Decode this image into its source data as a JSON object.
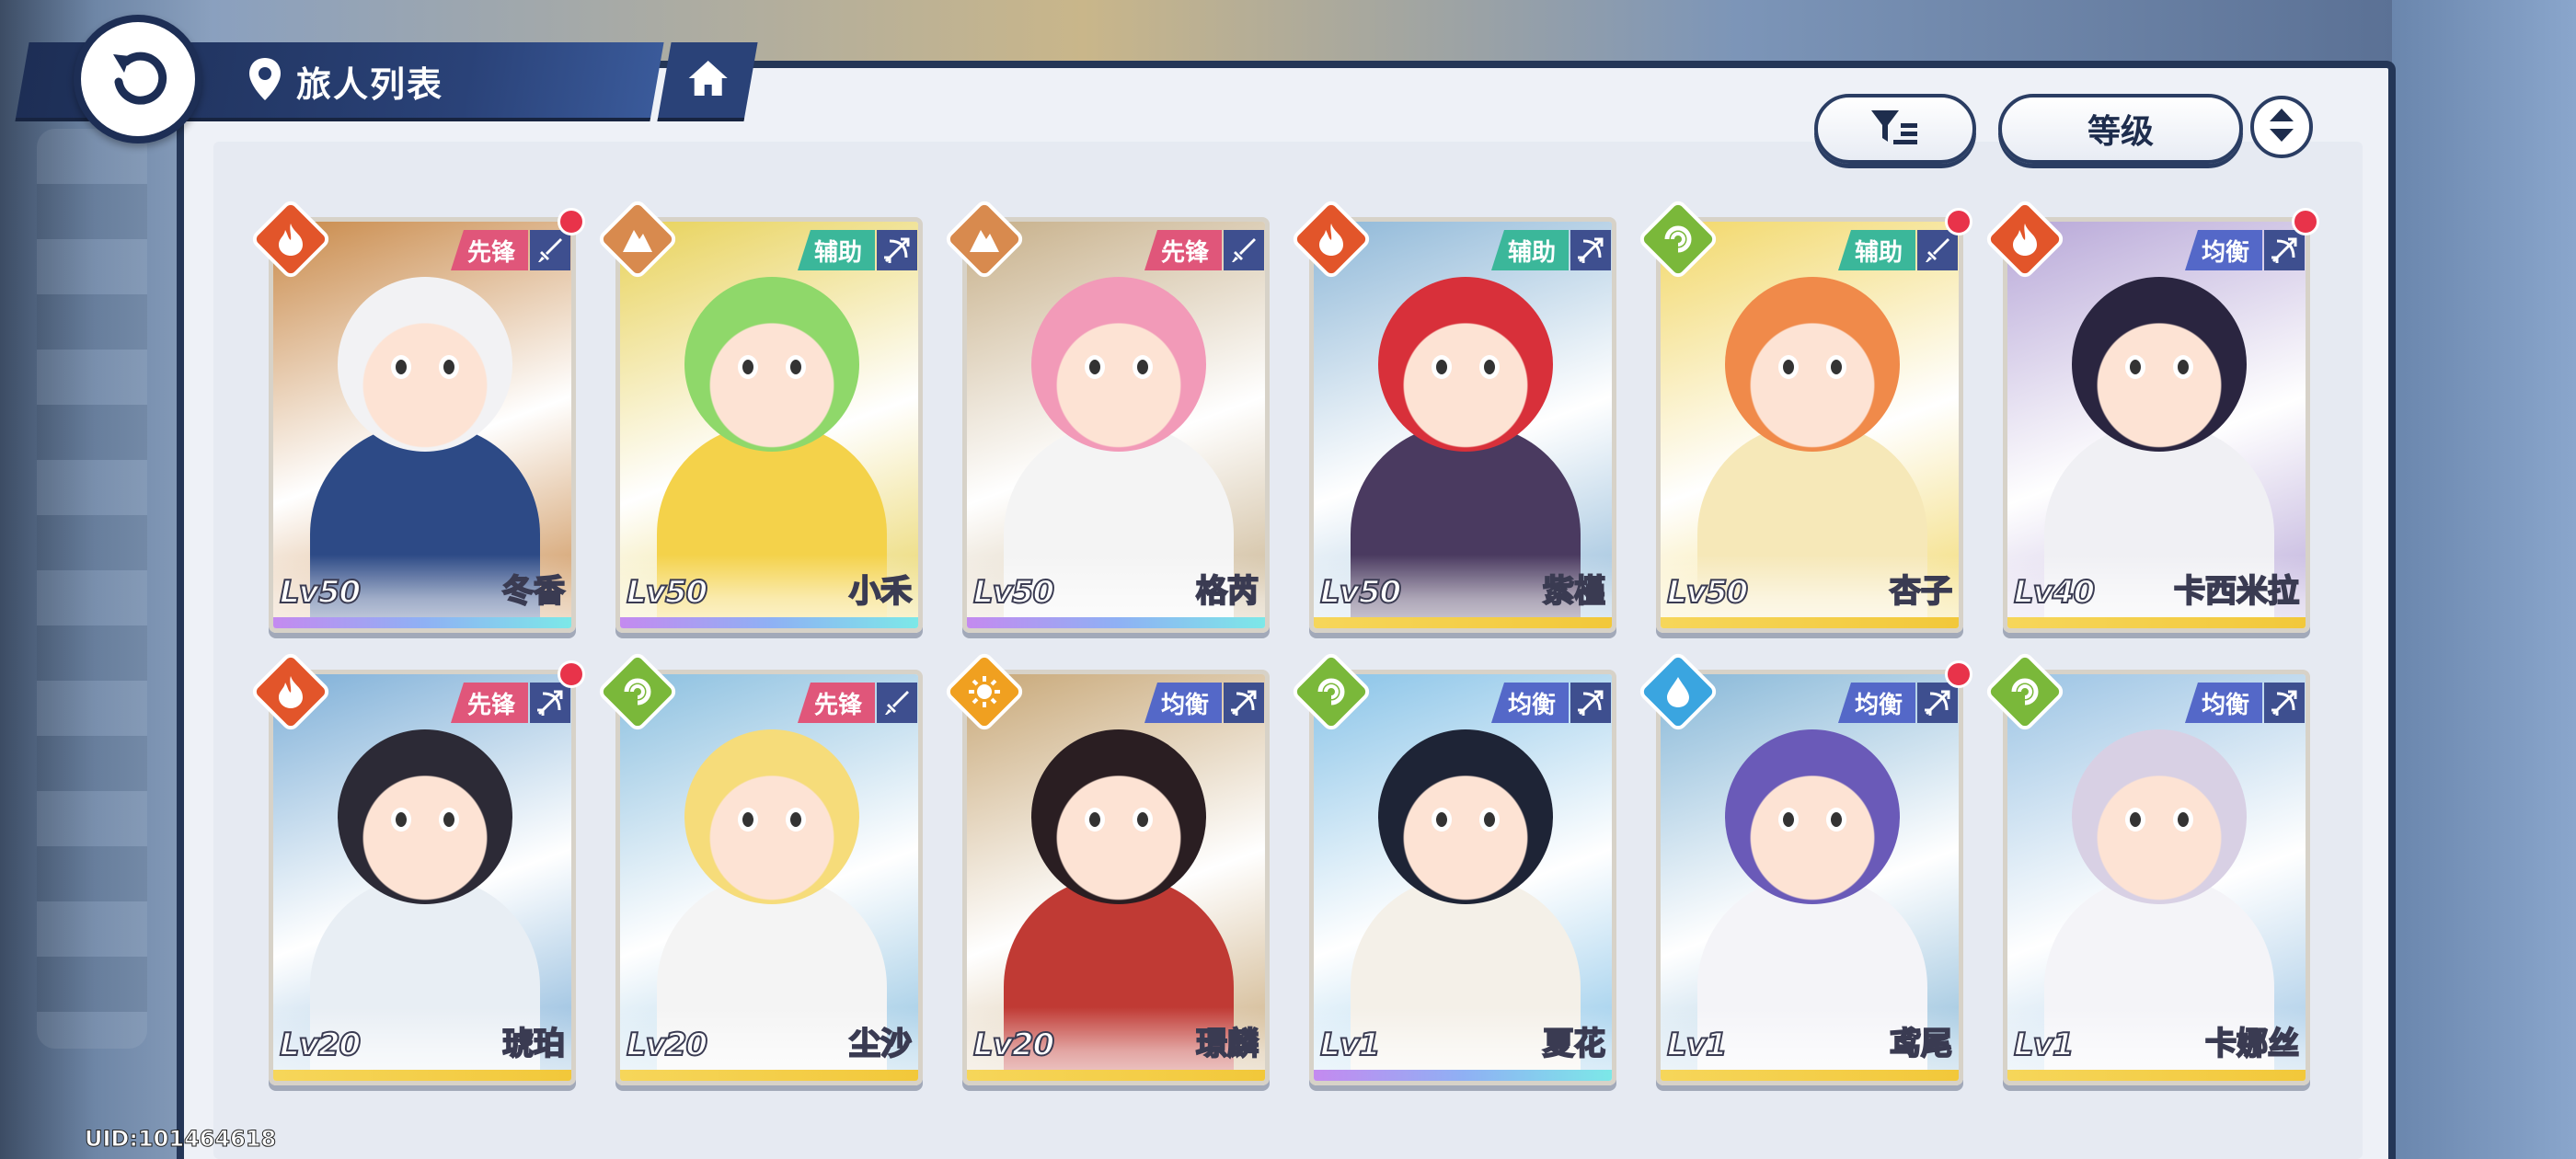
{
  "header": {
    "title": "旅人列表"
  },
  "controls": {
    "sort_label": "等级"
  },
  "uid_text": "UID:101464618",
  "colors": {
    "fire": "#e2552a",
    "wind": "#7ab83a",
    "earth": "#d88a4e",
    "water": "#3aa5e0",
    "light": "#f0a020",
    "vanguard": "#e0567a",
    "support": "#3bb79a",
    "balance": "#5468c8"
  },
  "characters": [
    {
      "name": "冬香",
      "level": "Lv50",
      "role": "先锋",
      "element": "fire",
      "weapon": "sword",
      "new": true,
      "hair": "#f2f2f4",
      "outfit": "#2d4a86",
      "bg": "#c98a4a",
      "bar": "gradient"
    },
    {
      "name": "小禾",
      "level": "Lv50",
      "role": "辅助",
      "element": "earth",
      "weapon": "bow",
      "new": false,
      "hair": "#8fd86a",
      "outfit": "#f4d24a",
      "bg": "#e8d25a",
      "bar": "gradient"
    },
    {
      "name": "格芮",
      "level": "Lv50",
      "role": "先锋",
      "element": "earth",
      "weapon": "sword",
      "new": false,
      "hair": "#f29ab8",
      "outfit": "#f4f4f4",
      "bg": "#c7b08a",
      "bar": "gradient"
    },
    {
      "name": "紫槿",
      "level": "Lv50",
      "role": "辅助",
      "element": "fire",
      "weapon": "bow",
      "new": false,
      "hair": "#d8303a",
      "outfit": "#4a3a60",
      "bg": "#8fb8d8",
      "bar": "gold"
    },
    {
      "name": "杏子",
      "level": "Lv50",
      "role": "辅助",
      "element": "wind",
      "weapon": "sword",
      "new": true,
      "hair": "#f08a4a",
      "outfit": "#f6e8b8",
      "bg": "#f2d86a",
      "bar": "gold"
    },
    {
      "name": "卡西米拉",
      "level": "Lv40",
      "role": "均衡",
      "element": "fire",
      "weapon": "bow",
      "new": true,
      "hair": "#2a2540",
      "outfit": "#f0f0f4",
      "bg": "#b8a8d8",
      "bar": "gold"
    },
    {
      "name": "琥珀",
      "level": "Lv20",
      "role": "先锋",
      "element": "fire",
      "weapon": "bow",
      "new": true,
      "hair": "#2c2a36",
      "outfit": "#e8eef4",
      "bg": "#7fb0d8",
      "bar": "gold"
    },
    {
      "name": "尘沙",
      "level": "Lv20",
      "role": "先锋",
      "element": "wind",
      "weapon": "sword",
      "new": false,
      "hair": "#f6dc7a",
      "outfit": "#f4f4f4",
      "bg": "#8cc0e0",
      "bar": "gold"
    },
    {
      "name": "璟麟",
      "level": "Lv20",
      "role": "均衡",
      "element": "light",
      "weapon": "bow",
      "new": false,
      "hair": "#2a1e22",
      "outfit": "#c03a34",
      "bg": "#c8a878",
      "bar": "gold"
    },
    {
      "name": "夏花",
      "level": "Lv1",
      "role": "均衡",
      "element": "wind",
      "weapon": "bow",
      "new": false,
      "hair": "#1e2436",
      "outfit": "#f4f0e8",
      "bg": "#8ac4e8",
      "bar": "gradient"
    },
    {
      "name": "鸢尾",
      "level": "Lv1",
      "role": "均衡",
      "element": "water",
      "weapon": "bow",
      "new": true,
      "hair": "#6a5ab8",
      "outfit": "#f4f4f8",
      "bg": "#88b8d8",
      "bar": "gold"
    },
    {
      "name": "卡娜丝",
      "level": "Lv1",
      "role": "均衡",
      "element": "wind",
      "weapon": "bow",
      "new": false,
      "hair": "#d8d0e4",
      "outfit": "#f4f4f8",
      "bg": "#9cc4e4",
      "bar": "gold"
    }
  ]
}
